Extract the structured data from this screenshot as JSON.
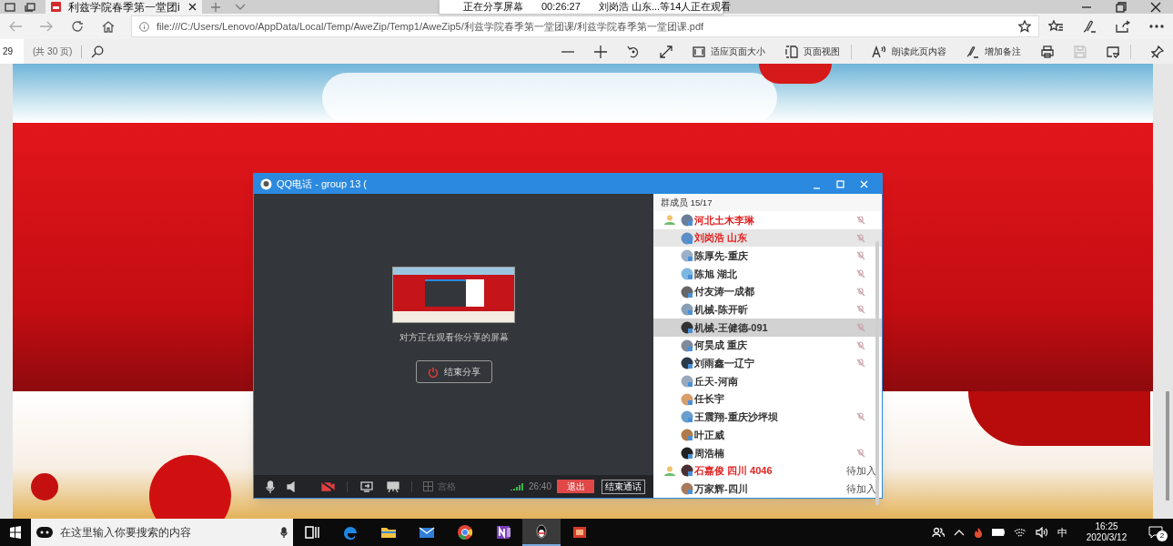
{
  "browser": {
    "tab": {
      "title": "利兹学院春季第一堂团i"
    },
    "share_notice": {
      "label": "正在分享屏幕",
      "time": "00:26:27",
      "viewers": "刘岗浩 山东...等14人正在观看"
    },
    "address": "file:///C:/Users/Lenovo/AppData/Local/Temp/AweZip/Temp1/AweZip5/利兹学院春季第一堂团课/利兹学院春季第一堂团课.pdf",
    "pdf_toolbar": {
      "page": "29",
      "total": "(共 30 页)",
      "tools": [
        {
          "kind": "minus",
          "disabled": false
        },
        {
          "kind": "plus",
          "disabled": false
        },
        {
          "kind": "rotate",
          "disabled": false
        },
        {
          "kind": "expand",
          "disabled": false
        },
        {
          "kind": "fit",
          "label": "适应页面大小",
          "disabled": false
        },
        {
          "kind": "view",
          "label": "页面视图",
          "disabled": false
        },
        {
          "kind": "read",
          "label": "朗读此页内容",
          "disabled": false
        },
        {
          "kind": "note",
          "label": "增加备注",
          "disabled": false
        },
        {
          "kind": "print",
          "disabled": false
        },
        {
          "kind": "save",
          "disabled": true
        },
        {
          "kind": "more",
          "disabled": false
        },
        {
          "kind": "pin",
          "disabled": false
        }
      ]
    }
  },
  "call_window": {
    "title": "QQ电话 - group 13 (",
    "share_status": "对方正在观看你分享的屏幕",
    "stop_share": "结束分享",
    "camera_on": false,
    "grid_label": "宫格",
    "duration": "26:40",
    "exit": "退出",
    "end_call": "结束通话",
    "members_header": "群成员 15/17",
    "members": [
      {
        "name": "河北土木李琳",
        "color": "#e02424",
        "host": true,
        "muted": true,
        "selected": false,
        "hovered": false
      },
      {
        "name": "刘岗浩 山东",
        "color": "#e02424",
        "host": false,
        "muted": true,
        "selected": false,
        "hovered": true
      },
      {
        "name": "陈厚先-重庆",
        "color": "#333333",
        "host": false,
        "muted": true,
        "selected": false,
        "hovered": false
      },
      {
        "name": "陈旭 湖北",
        "color": "#333333",
        "host": false,
        "muted": true,
        "selected": false,
        "hovered": false
      },
      {
        "name": "付友涛一成都",
        "color": "#333333",
        "host": false,
        "muted": true,
        "selected": false,
        "hovered": false
      },
      {
        "name": "机械-陈开昕",
        "color": "#333333",
        "host": false,
        "muted": true,
        "selected": false,
        "hovered": false
      },
      {
        "name": "机械-王健德-091",
        "color": "#333333",
        "host": false,
        "muted": true,
        "selected": true,
        "hovered": false
      },
      {
        "name": "何昊成 重庆",
        "color": "#333333",
        "host": false,
        "muted": true,
        "selected": false,
        "hovered": false
      },
      {
        "name": "刘雨鑫一辽宁",
        "color": "#333333",
        "host": false,
        "muted": true,
        "selected": false,
        "hovered": false
      },
      {
        "name": "丘天-河南",
        "color": "#333333",
        "host": false,
        "muted": false,
        "selected": false,
        "hovered": false
      },
      {
        "name": "任长宇",
        "color": "#333333",
        "host": false,
        "muted": false,
        "selected": false,
        "hovered": false
      },
      {
        "name": "王震翔-重庆沙坪坝",
        "color": "#333333",
        "host": false,
        "muted": true,
        "selected": false,
        "hovered": false
      },
      {
        "name": "叶正威",
        "color": "#333333",
        "host": false,
        "muted": false,
        "selected": false,
        "hovered": false
      },
      {
        "name": "周浩楠",
        "color": "#333333",
        "host": false,
        "muted": true,
        "selected": false,
        "hovered": false
      },
      {
        "name": "石嘉俊 四川 4046",
        "color": "#e02424",
        "host": true,
        "muted": false,
        "status": "待加入",
        "selected": false,
        "hovered": false
      },
      {
        "name": "万家辉-四川",
        "color": "#333333",
        "host": false,
        "muted": false,
        "status": "待加入",
        "selected": false,
        "hovered": false
      }
    ]
  },
  "taskbar": {
    "search_placeholder": "在这里输入你要搜索的内容",
    "apps": [
      {
        "kind": "taskview",
        "selected": false
      },
      {
        "kind": "edge",
        "selected": false
      },
      {
        "kind": "explorer",
        "selected": false
      },
      {
        "kind": "mail",
        "selected": false
      },
      {
        "kind": "chrome",
        "selected": false
      },
      {
        "kind": "onenote",
        "selected": false
      },
      {
        "kind": "qq",
        "selected": true
      },
      {
        "kind": "slides",
        "selected": false
      }
    ],
    "ime": "中",
    "time": "16:25",
    "date": "2020/3/12",
    "notifications": "2"
  }
}
